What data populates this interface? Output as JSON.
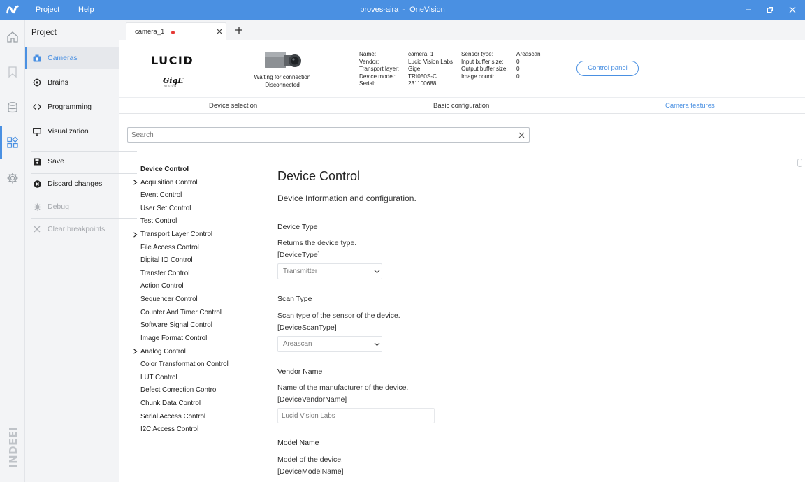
{
  "titlebar": {
    "menu": [
      "Project",
      "Help"
    ],
    "title": "proves-aira  -  OneVision",
    "bg": "#4a90e2"
  },
  "rail": {
    "icons": [
      "home-icon",
      "bookmark-icon",
      "database-icon",
      "apps-icon",
      "settings-icon"
    ],
    "brand": "INDEEP"
  },
  "sidebar": {
    "heading": "Project",
    "items": [
      {
        "label": "Cameras",
        "icon": "camera-icon",
        "active": true
      },
      {
        "label": "Brains",
        "icon": "brain-icon"
      },
      {
        "label": "Programming",
        "icon": "code-icon"
      },
      {
        "label": "Visualization",
        "icon": "monitor-icon"
      }
    ],
    "actions": [
      {
        "label": "Save",
        "icon": "save-icon"
      },
      {
        "label": "Discard changes",
        "icon": "discard-icon"
      },
      {
        "label": "Debug",
        "icon": "bug-icon",
        "disabled": true
      },
      {
        "label": "Clear breakpoints",
        "icon": "close-icon",
        "disabled": true
      }
    ]
  },
  "tabs": [
    {
      "label": "camera_1",
      "unsaved": true
    }
  ],
  "device": {
    "brand_logo": "LUCID",
    "gige_logo": "GigE",
    "gige_sub": "VISION",
    "status_line1": "Waiting for connection",
    "status_line2": "Disconnected",
    "info_left": [
      {
        "k": "Name:",
        "v": "camera_1"
      },
      {
        "k": "Vendor:",
        "v": "Lucid Vision Labs"
      },
      {
        "k": "Transport layer:",
        "v": "Gige"
      },
      {
        "k": "Device model:",
        "v": "TRI050S-C"
      },
      {
        "k": "Serial:",
        "v": "231100688"
      }
    ],
    "info_right": [
      {
        "k": "Sensor type:",
        "v": "Areascan"
      },
      {
        "k": "Input buffer size:",
        "v": "0"
      },
      {
        "k": "Output buffer size:",
        "v": "0"
      },
      {
        "k": "Image count:",
        "v": "0"
      }
    ],
    "control_panel": "Control panel"
  },
  "subtabs": [
    {
      "label": "Device selection"
    },
    {
      "label": "Basic configuration"
    },
    {
      "label": "Camera features",
      "active": true
    }
  ],
  "search": {
    "placeholder": "Search",
    "value": ""
  },
  "tree": [
    {
      "label": "Device Control",
      "bold": true
    },
    {
      "label": "Acquisition Control",
      "expandable": true
    },
    {
      "label": "Event Control"
    },
    {
      "label": "User Set Control"
    },
    {
      "label": "Test Control"
    },
    {
      "label": "Transport Layer Control",
      "expandable": true
    },
    {
      "label": "File Access Control"
    },
    {
      "label": "Digital IO Control"
    },
    {
      "label": "Transfer Control"
    },
    {
      "label": "Action Control"
    },
    {
      "label": "Sequencer Control"
    },
    {
      "label": "Counter And Timer Control"
    },
    {
      "label": "Software Signal Control"
    },
    {
      "label": "Image Format Control"
    },
    {
      "label": "Analog Control",
      "expandable": true
    },
    {
      "label": "Color Transformation Control"
    },
    {
      "label": "LUT Control"
    },
    {
      "label": "Defect Correction Control"
    },
    {
      "label": "Chunk Data Control"
    },
    {
      "label": "Serial Access Control"
    },
    {
      "label": "I2C Access Control"
    }
  ],
  "detail": {
    "title": "Device Control",
    "description": "Device Information and configuration.",
    "fields": [
      {
        "title": "Device Type",
        "desc": "Returns the device type.",
        "key": "[DeviceType]",
        "value": "Transmitter"
      },
      {
        "title": "Scan Type",
        "desc": "Scan type of the sensor of the device.",
        "key": "[DeviceScanType]",
        "value": "Areascan"
      },
      {
        "title": "Vendor Name",
        "desc": "Name of the manufacturer of the device.",
        "key": "[DeviceVendorName]",
        "value": "Lucid Vision Labs"
      },
      {
        "title": "Model Name",
        "desc": "Model of the device.",
        "key": "[DeviceModelName]"
      }
    ]
  }
}
